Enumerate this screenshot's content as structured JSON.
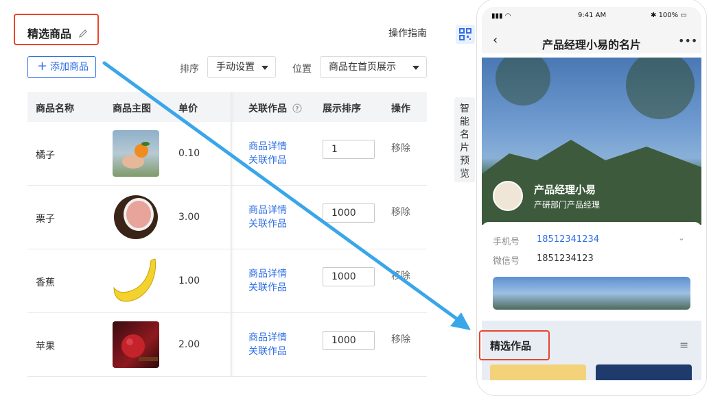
{
  "header": {
    "title": "精选商品",
    "guide_link": "操作指南",
    "add_button": "添加商品",
    "sort_label": "排序",
    "sort_value": "手动设置",
    "position_label": "位置",
    "position_value": "商品在首页展示"
  },
  "table": {
    "columns": [
      "商品名称",
      "商品主图",
      "单价",
      "关联作品",
      "展示排序",
      "操作"
    ],
    "rows": [
      {
        "name": "橘子",
        "price": "0.10",
        "link1": "商品详情",
        "link2": "关联作品",
        "order": "1",
        "action": "移除"
      },
      {
        "name": "栗子",
        "price": "3.00",
        "link1": "商品详情",
        "link2": "关联作品",
        "order": "1000",
        "action": "移除"
      },
      {
        "name": "香蕉",
        "price": "1.00",
        "link1": "商品详情",
        "link2": "关联作品",
        "order": "1000",
        "action": "移除"
      },
      {
        "name": "苹果",
        "price": "2.00",
        "link1": "商品详情",
        "link2": "关联作品",
        "order": "1000",
        "action": "移除"
      }
    ]
  },
  "side_tab": [
    "智",
    "能",
    "名",
    "片",
    "预",
    "览"
  ],
  "phone": {
    "status_time": "9:41 AM",
    "battery": "100%",
    "nav_title": "产品经理小易的名片",
    "profile_name": "产品经理小易",
    "profile_dept": "产研部门产品经理",
    "phone_label": "手机号",
    "phone_value": "18512341234",
    "wechat_label": "微信号",
    "wechat_value": "1851234123",
    "section_title": "精选作品"
  },
  "colors": {
    "accent": "#2f6fe4",
    "highlight": "#e8452c",
    "arrow": "#3aa6ea"
  }
}
